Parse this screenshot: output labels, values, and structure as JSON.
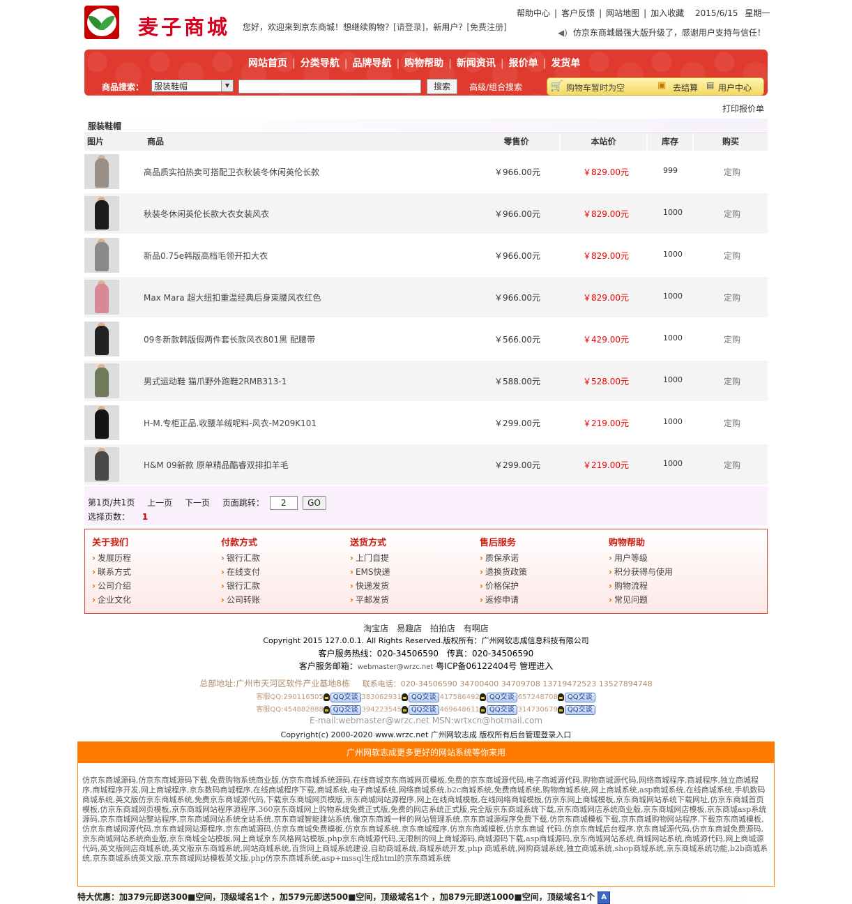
{
  "header": {
    "brand": "麦子商城",
    "welcome_text": "您好，欢迎来到京东商城！想继续购物？",
    "login_link": "[请登录]",
    "new_user_text": "，新用户？",
    "register_link": "[免费注册]",
    "top_links": [
      "帮助中心",
      "客户反馈",
      "网站地图",
      "加入收藏"
    ],
    "date": "2015/6/15",
    "weekday": "星期一",
    "notice": "仿京东商城最强大版升级了，感谢用户支持与信任！"
  },
  "nav": {
    "items": [
      "网站首页",
      "分类导航",
      "品牌导航",
      "购物帮助",
      "新闻资讯",
      "报价单",
      "发货单"
    ]
  },
  "search": {
    "label": "商品搜索：",
    "category_value": "服装鞋帽",
    "button": "搜索",
    "advanced": "高级/组合搜索"
  },
  "cart": {
    "status": "购物车暂时为空",
    "checkout": "去结算",
    "user_center": "用户中心"
  },
  "print_link": "打印报价单",
  "category_title": "服装鞋帽",
  "table": {
    "headers": [
      "图片",
      "商品",
      "零售价",
      "本站价",
      "库存",
      "购买"
    ],
    "rows": [
      {
        "name": "高品质实拍热卖可搭配卫衣秋装冬休闲英伦长款",
        "retail": "￥966.00元",
        "price": "￥829.00元",
        "stock": "999",
        "order": "定购",
        "color": "#9a8f86"
      },
      {
        "name": "秋装冬休闲英伦长款大衣女装风衣",
        "retail": "￥966.00元",
        "price": "￥829.00元",
        "stock": "1000",
        "order": "定购",
        "color": "#1c1c1c"
      },
      {
        "name": "新品0.75e韩版高档毛领开扣大衣",
        "retail": "￥966.00元",
        "price": "￥829.00元",
        "stock": "1000",
        "order": "定购",
        "color": "#8a8a8a"
      },
      {
        "name": "Max Mara 超大纽扣重温经典后身束腰风衣红色",
        "retail": "￥966.00元",
        "price": "￥829.00元",
        "stock": "1000",
        "order": "定购",
        "color": "#d98896"
      },
      {
        "name": "09冬新款韩版假两件套长款风衣801黑 配腰带",
        "retail": "￥566.00元",
        "price": "￥429.00元",
        "stock": "1000",
        "order": "定购",
        "color": "#222222"
      },
      {
        "name": "男式运动鞋 猫爪野外跑鞋2RMB313-1",
        "retail": "￥588.00元",
        "price": "￥528.00元",
        "stock": "1000",
        "order": "定购",
        "color": "#6f7a5a"
      },
      {
        "name": "H-M.专柜正品.收腰羊绒呢料-风衣-M209K101",
        "retail": "￥299.00元",
        "price": "￥219.00元",
        "stock": "1000",
        "order": "定购",
        "color": "#141414"
      },
      {
        "name": "H&M 09新款 原单精品酷睿双排扣羊毛",
        "retail": "￥299.00元",
        "price": "￥219.00元",
        "stock": "1000",
        "order": "定购",
        "color": "#4a4a4a"
      }
    ]
  },
  "pager": {
    "summary": "第1页/共1页",
    "prev": "上一页",
    "next": "下一页",
    "jump_label": "页面跳转：",
    "jump_value": "2",
    "go": "GO",
    "select_label": "选择页数：",
    "current": "1"
  },
  "help": [
    {
      "title": "关于我们",
      "items": [
        "发展历程",
        "联系方式",
        "公司介绍",
        "企业文化"
      ]
    },
    {
      "title": "付款方式",
      "items": [
        "银行汇款",
        "在线支付",
        "银行汇款",
        "公司转账"
      ]
    },
    {
      "title": "送货方式",
      "items": [
        "上门自提",
        "EMS快递",
        "快递发货",
        "平邮发货"
      ]
    },
    {
      "title": "售后服务",
      "items": [
        "质保承诺",
        "退换货政策",
        "价格保护",
        "返修申请"
      ]
    },
    {
      "title": "购物帮助",
      "items": [
        "用户等级",
        "积分获得与使用",
        "购物流程",
        "常见问题"
      ]
    }
  ],
  "footer": {
    "shops": [
      "淘宝店",
      "易趣店",
      "拍拍店",
      "有啊店"
    ],
    "copyright": "Copyright 2015 127.0.0.1. All Rights Reserved.版权所有：广州网软志成信息科技有限公司",
    "hotline": "客户服务热线：020-34506590　传真：020-34506590",
    "email_label": "客户服务邮箱：",
    "email": "webmaster@wrzc.net",
    "icp": "粤ICP备06122404号 管理进入",
    "address": "总部地址:广州市天河区软件产业基地8栋",
    "phones": "联系电话：020-34506590 34700400 34709708 13719472523 13527894748",
    "qq_label": "客服QQ:",
    "qq_row1": [
      "290116505",
      "383062931",
      "417586492",
      "657248708"
    ],
    "qq_row2": [
      "454882888",
      "394223545",
      "469648611",
      "314730679"
    ],
    "qq_button": "QQ交谈",
    "email_msn": "E-mail:webmaster@wrzc.net MSN:wrtxcn@hotmail.com",
    "copyright2": "Copyright(c) 2000-2020 www.wrzc.net 广州网软志成 版权所有后台管理登录入口"
  },
  "promo": {
    "header": "广州网软志成更多更好的网站系统等你来用",
    "text": "仿京东商城源码,仿京东商城源码下载,免费购物系统商业版,仿京东商城系统源码,在线商城京东商城网页模板,免费的京东商城源代码,电子商城源代码,购物商城源代码,网络商城程序,商城程序,独立商城程序,商城程序开发,网上商城程序,京东数码商城程序,在线商城程序下载,商城系统,电子商城系统,网络商城系统,b2c商城系统,免费商城系统,购物商城系统,网上商城系统,asp商城系统,在线商城系统,手机数码商城系统,英文版仿京东商城系统,免费京东商城源代码,下载京东商城网页模版,京东商城网站源程序,网上在线商城模板,在线网络商城模板,仿京东网上商城模板,京东商城网站系统下载网址,仿京东商城首页模板,仿京东商城网页模板,京东商城网站程序源程序,360京东商城网上购物系统免费正式版,免费的网店系统正式版,完全版京东商城系统下载,京东商城网店系统商业版,京东商城网店模板,京东商城asp系统源码,京东商城网站整站程序,京东商城网站系统全站系统,京东商城智能建站系统,像京东商城一样的网站管理系统,京东商城源程序免费下载,仿京东商城模板下载,京东商城购物网站程序,下载京东商城模板,仿京东商城网源代码,京东商城网站源程序,京东商城源码,仿京东商城免费模板,仿京东商城系统,京东商城程序,仿京东商城模板,仿京东商城 代码,仿京东商城后台程序,京东商城源代码,仿京东商城免费源码,京东商城网站系统商业版,京东商城全站模板,网上商城京东风格网站模板,php京东商城源代码,无限制的网上商城源码,商城源码下载,asp商城源码,京东商城网站系统,商城网站系统,商城源代码,网上商城源代码,英文版网店商城系统,英文版京东商城系统,网站商城系统,百货网上商城系统建设,自助商城系统,商城系统开发,php 商城系统,网购商城系统,独立商城系统,shop商城系统,京东商城系统功能,b2b商城系统,京东商城系统英文版,京东商城网站模板英文版,php仿京东商城系统,asp+mssql生成html的京东商城系统"
  },
  "special": "特大优惠：加379元即送300■空间，顶级域名1个 ，加579元即送500■空间，顶级域名1个 ，加879元即送1000■空间，顶级域名1个"
}
